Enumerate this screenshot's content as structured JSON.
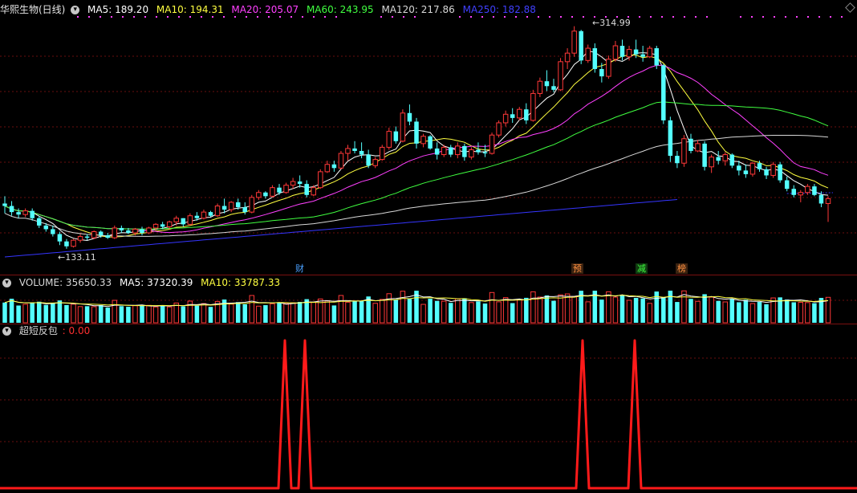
{
  "stock": {
    "name": "华熙生物(日线)",
    "ma_items": [
      {
        "label": "MA5: 189.20",
        "color": "#ffffff"
      },
      {
        "label": "MA10: 194.31",
        "color": "#ffff40"
      },
      {
        "label": "MA20: 205.07",
        "color": "#ff40ff"
      },
      {
        "label": "MA60: 243.95",
        "color": "#40ff40"
      },
      {
        "label": "MA120: 217.86",
        "color": "#d8d8d8"
      },
      {
        "label": "MA250: 182.88",
        "color": "#4040ff"
      }
    ],
    "high_label": "314.99",
    "low_label": "133.11"
  },
  "volume": {
    "items": [
      {
        "label": "VOLUME: 35650.33",
        "color": "#d8d8d8"
      },
      {
        "label": "MA5: 37320.39",
        "color": "#ffffff"
      },
      {
        "label": "MA10: 33787.33",
        "color": "#ffff40"
      }
    ]
  },
  "indicator": {
    "name": "超短反包",
    "value": ": 0.00",
    "value_color": "#ff3030"
  },
  "event_tags": [
    {
      "text": "财",
      "color": "#4aa0ff"
    },
    {
      "text": "预",
      "color": "#ff9040"
    },
    {
      "text": "减",
      "color": "#40ff40"
    },
    {
      "text": "榜",
      "color": "#ff9040"
    }
  ],
  "colors": {
    "up": "#ff3838",
    "down": "#54ffff",
    "grid": "#6a0e0e",
    "signal": "#ff1a1a"
  },
  "chart_data": {
    "type": "candlestick",
    "price_range": [
      125,
      322
    ],
    "candles": [
      [
        170,
        176,
        162,
        168
      ],
      [
        168,
        172,
        160,
        163
      ],
      [
        163,
        166,
        158,
        161
      ],
      [
        161,
        166,
        159,
        164
      ],
      [
        164,
        166,
        156,
        158
      ],
      [
        158,
        160,
        150,
        152
      ],
      [
        152,
        154,
        147,
        149
      ],
      [
        149,
        152,
        143,
        145
      ],
      [
        145,
        147,
        136,
        139
      ],
      [
        139,
        141,
        133,
        135
      ],
      [
        135,
        141,
        134,
        140
      ],
      [
        140,
        145,
        138,
        143
      ],
      [
        143,
        145,
        140,
        142
      ],
      [
        142,
        148,
        141,
        147
      ],
      [
        147,
        148,
        142,
        144
      ],
      [
        144,
        146,
        141,
        142
      ],
      [
        142,
        152,
        141,
        150
      ],
      [
        150,
        152,
        146,
        148
      ],
      [
        148,
        150,
        145,
        146
      ],
      [
        146,
        150,
        144,
        149
      ],
      [
        149,
        151,
        144,
        146
      ],
      [
        146,
        151,
        145,
        150
      ],
      [
        150,
        154,
        148,
        153
      ],
      [
        153,
        155,
        149,
        151
      ],
      [
        151,
        156,
        149,
        155
      ],
      [
        155,
        160,
        152,
        158
      ],
      [
        158,
        158,
        151,
        153
      ],
      [
        153,
        162,
        152,
        160
      ],
      [
        160,
        163,
        156,
        158
      ],
      [
        158,
        165,
        157,
        163
      ],
      [
        163,
        164,
        159,
        160
      ],
      [
        160,
        170,
        159,
        168
      ],
      [
        168,
        174,
        162,
        165
      ],
      [
        165,
        172,
        163,
        171
      ],
      [
        171,
        174,
        165,
        167
      ],
      [
        167,
        171,
        161,
        163
      ],
      [
        163,
        177,
        162,
        175
      ],
      [
        175,
        181,
        173,
        179
      ],
      [
        179,
        180,
        174,
        176
      ],
      [
        176,
        185,
        175,
        183
      ],
      [
        183,
        186,
        177,
        179
      ],
      [
        179,
        187,
        178,
        185
      ],
      [
        185,
        191,
        182,
        188
      ],
      [
        188,
        193,
        183,
        186
      ],
      [
        186,
        189,
        175,
        177
      ],
      [
        177,
        185,
        176,
        183
      ],
      [
        183,
        198,
        182,
        196
      ],
      [
        196,
        205,
        195,
        202
      ],
      [
        202,
        205,
        196,
        199
      ],
      [
        199,
        213,
        198,
        211
      ],
      [
        211,
        218,
        205,
        215
      ],
      [
        215,
        221,
        211,
        213
      ],
      [
        213,
        220,
        207,
        210
      ],
      [
        210,
        214,
        199,
        201
      ],
      [
        201,
        208,
        199,
        206
      ],
      [
        206,
        218,
        205,
        216
      ],
      [
        216,
        232,
        214,
        229
      ],
      [
        229,
        233,
        219,
        221
      ],
      [
        221,
        247,
        220,
        244
      ],
      [
        244,
        251,
        234,
        237
      ],
      [
        237,
        240,
        215,
        219
      ],
      [
        219,
        227,
        216,
        225
      ],
      [
        225,
        226,
        214,
        215
      ],
      [
        215,
        220,
        206,
        210
      ],
      [
        210,
        218,
        208,
        216
      ],
      [
        216,
        218,
        208,
        210
      ],
      [
        210,
        220,
        207,
        217
      ],
      [
        217,
        219,
        205,
        208
      ],
      [
        208,
        216,
        206,
        214
      ],
      [
        214,
        220,
        210,
        212
      ],
      [
        212,
        218,
        208,
        211
      ],
      [
        211,
        228,
        210,
        226
      ],
      [
        226,
        238,
        224,
        236
      ],
      [
        236,
        246,
        233,
        243
      ],
      [
        243,
        248,
        236,
        240
      ],
      [
        240,
        249,
        238,
        247
      ],
      [
        247,
        252,
        235,
        238
      ],
      [
        238,
        263,
        237,
        260
      ],
      [
        260,
        273,
        257,
        270
      ],
      [
        270,
        279,
        262,
        266
      ],
      [
        266,
        272,
        261,
        263
      ],
      [
        263,
        289,
        262,
        286
      ],
      [
        286,
        297,
        280,
        293
      ],
      [
        293,
        315,
        290,
        311
      ],
      [
        311,
        312,
        284,
        287
      ],
      [
        287,
        300,
        285,
        297
      ],
      [
        297,
        301,
        277,
        280
      ],
      [
        280,
        285,
        269,
        274
      ],
      [
        274,
        291,
        272,
        288
      ],
      [
        288,
        303,
        286,
        299
      ],
      [
        299,
        304,
        287,
        290
      ],
      [
        290,
        299,
        287,
        296
      ],
      [
        296,
        304,
        289,
        292
      ],
      [
        292,
        299,
        286,
        290
      ],
      [
        290,
        299,
        289,
        297
      ],
      [
        297,
        299,
        280,
        283
      ],
      [
        283,
        284,
        235,
        238
      ],
      [
        238,
        241,
        204,
        209
      ],
      [
        209,
        213,
        199,
        203
      ],
      [
        203,
        226,
        200,
        223
      ],
      [
        223,
        227,
        211,
        213
      ],
      [
        213,
        222,
        212,
        219
      ],
      [
        219,
        221,
        197,
        200
      ],
      [
        200,
        210,
        195,
        208
      ],
      [
        208,
        213,
        202,
        205
      ],
      [
        205,
        212,
        201,
        210
      ],
      [
        210,
        211,
        199,
        201
      ],
      [
        201,
        205,
        193,
        197
      ],
      [
        197,
        202,
        191,
        194
      ],
      [
        194,
        204,
        192,
        203
      ],
      [
        203,
        205,
        196,
        198
      ],
      [
        198,
        200,
        190,
        193
      ],
      [
        193,
        204,
        191,
        202
      ],
      [
        202,
        204,
        187,
        189
      ],
      [
        189,
        192,
        180,
        182
      ],
      [
        182,
        185,
        175,
        177
      ],
      [
        177,
        181,
        171,
        179
      ],
      [
        179,
        186,
        177,
        184
      ],
      [
        184,
        186,
        176,
        177
      ],
      [
        177,
        180,
        167,
        170
      ],
      [
        170,
        176,
        155,
        174
      ]
    ]
  }
}
